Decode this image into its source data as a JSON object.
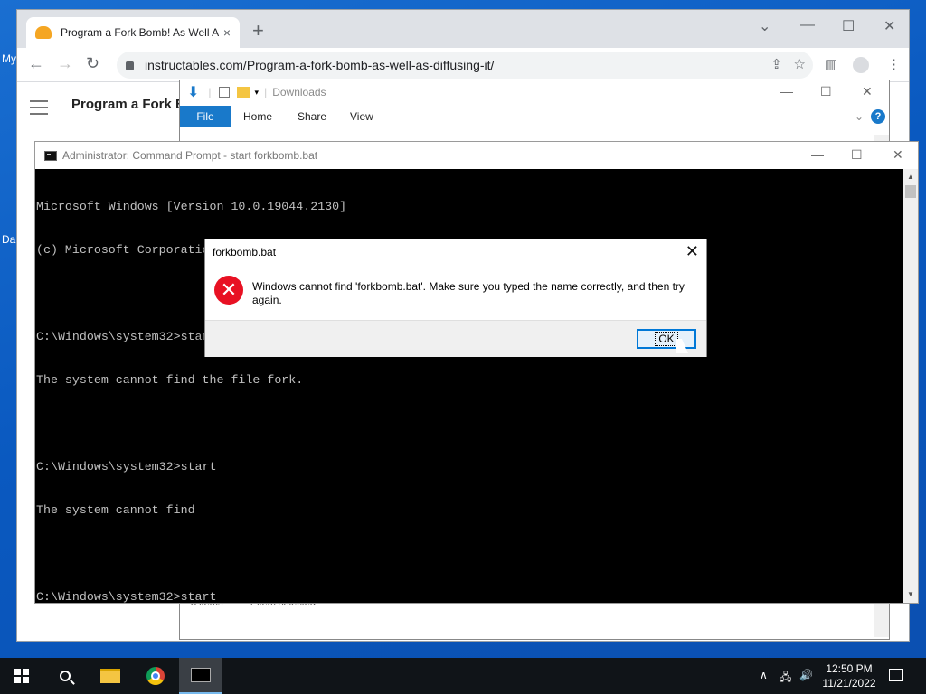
{
  "desktop": {
    "edge_labels": [
      "My",
      "Da"
    ]
  },
  "browser": {
    "tab_title": "Program a Fork Bomb! As Well A",
    "tab_close": "×",
    "new_tab": "+",
    "url": "instructables.com/Program-a-fork-bomb-as-well-as-diffusing-it/",
    "page_title": "Program a Fork Bo",
    "controls": {
      "dropdown": "⌄",
      "minimize": "—",
      "maximize": "☐",
      "close": "✕"
    },
    "nav": {
      "back": "←",
      "forward": "→",
      "reload": "↻"
    }
  },
  "explorer": {
    "title": "Downloads",
    "tabs": [
      "File",
      "Home",
      "Share",
      "View"
    ],
    "help": "?",
    "status_items": "3 items",
    "status_selected": "1 item selected",
    "controls": {
      "minimize": "—",
      "maximize": "☐",
      "close": "✕"
    }
  },
  "cmd": {
    "title": "Administrator: Command Prompt - start  forkbomb.bat",
    "lines": [
      "Microsoft Windows [Version 10.0.19044.2130]",
      "(c) Microsoft Corporation. All rights reserved.",
      "",
      "C:\\Windows\\system32>start fork bomb.bat",
      "The system cannot find the file fork.",
      "",
      "C:\\Windows\\system32>start",
      "The system cannot find",
      "",
      "C:\\Windows\\system32>start"
    ],
    "controls": {
      "minimize": "—",
      "maximize": "☐",
      "close": "✕"
    }
  },
  "dialog": {
    "title": "forkbomb.bat",
    "message": "Windows cannot find 'forkbomb.bat'. Make sure you typed the name correctly, and then try again.",
    "ok_label": "OK",
    "close": "✕",
    "error_glyph": "✕"
  },
  "taskbar": {
    "time": "12:50 PM",
    "date": "11/21/2022",
    "tray": {
      "chevron": "∧",
      "network": "🖧",
      "volume": "🔊"
    }
  }
}
